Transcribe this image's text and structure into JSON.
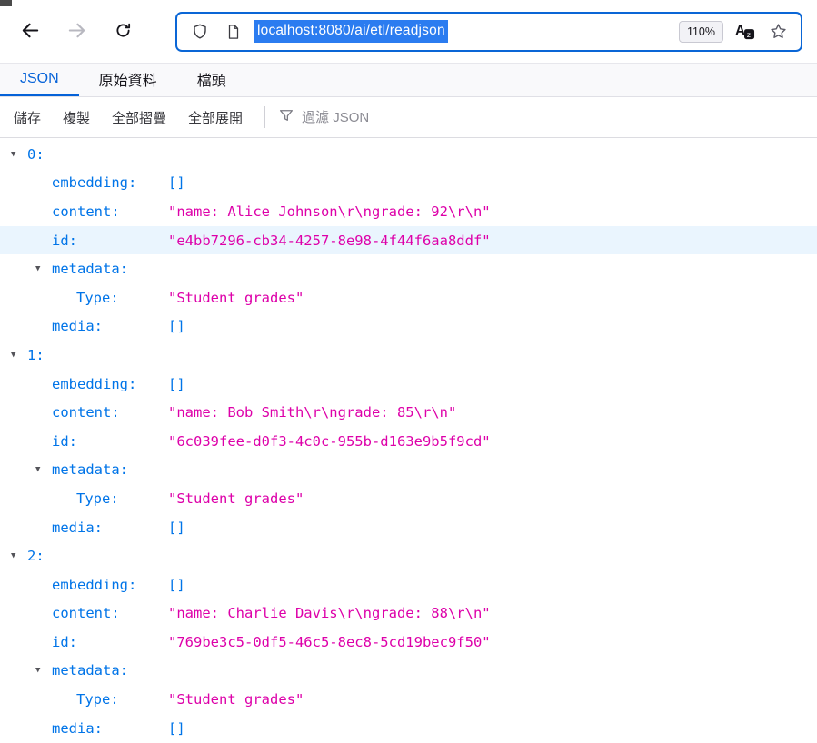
{
  "browser": {
    "url": "localhost:8080/ai/etl/readjson",
    "zoom": "110%"
  },
  "viewer_tabs": [
    {
      "name": "tab-json",
      "label": "JSON",
      "active": true
    },
    {
      "name": "tab-raw-data",
      "label": "原始資料",
      "active": false
    },
    {
      "name": "tab-headers",
      "label": "檔頭",
      "active": false
    }
  ],
  "toolbar": {
    "save": "儲存",
    "copy": "複製",
    "collapse_all": "全部摺疊",
    "expand_all": "全部展開",
    "filter_placeholder": "過濾 JSON"
  },
  "colors": {
    "key_blue": "#0074e8",
    "string_magenta": "#dd00a9",
    "accent_blue": "#0562d8",
    "url_selection_blue": "#2b7cf0",
    "row_highlight": "#eaf5fe"
  },
  "icons": {
    "back": "back-arrow-icon",
    "forward": "forward-arrow-icon",
    "reload": "reload-icon",
    "shield": "shield-icon",
    "page_info": "page-info-icon",
    "translate": "translate-icon",
    "bookmark": "bookmark-star-icon",
    "filter": "filter-funnel-icon",
    "expand": "expand-arrow-icon"
  },
  "tree_rows": [
    {
      "arrow": true,
      "indent": 0,
      "key": "0:",
      "value": "",
      "vtype": ""
    },
    {
      "arrow": false,
      "indent": 1,
      "key": "embedding:",
      "value": "[]",
      "vtype": "arr"
    },
    {
      "arrow": false,
      "indent": 1,
      "key": "content:",
      "value": "\"name: Alice Johnson\\r\\ngrade: 92\\r\\n\"",
      "vtype": "str"
    },
    {
      "arrow": false,
      "indent": 1,
      "key": "id:",
      "value": "\"e4bb7296-cb34-4257-8e98-4f44f6aa8ddf\"",
      "vtype": "str",
      "highlight": true
    },
    {
      "arrow": true,
      "indent": 1,
      "key": "metadata:",
      "value": "",
      "vtype": ""
    },
    {
      "arrow": false,
      "indent": 2,
      "key": "Type:",
      "value": "\"Student grades\"",
      "vtype": "str"
    },
    {
      "arrow": false,
      "indent": 1,
      "key": "media:",
      "value": "[]",
      "vtype": "arr"
    },
    {
      "arrow": true,
      "indent": 0,
      "key": "1:",
      "value": "",
      "vtype": ""
    },
    {
      "arrow": false,
      "indent": 1,
      "key": "embedding:",
      "value": "[]",
      "vtype": "arr"
    },
    {
      "arrow": false,
      "indent": 1,
      "key": "content:",
      "value": "\"name: Bob Smith\\r\\ngrade: 85\\r\\n\"",
      "vtype": "str"
    },
    {
      "arrow": false,
      "indent": 1,
      "key": "id:",
      "value": "\"6c039fee-d0f3-4c0c-955b-d163e9b5f9cd\"",
      "vtype": "str"
    },
    {
      "arrow": true,
      "indent": 1,
      "key": "metadata:",
      "value": "",
      "vtype": ""
    },
    {
      "arrow": false,
      "indent": 2,
      "key": "Type:",
      "value": "\"Student grades\"",
      "vtype": "str"
    },
    {
      "arrow": false,
      "indent": 1,
      "key": "media:",
      "value": "[]",
      "vtype": "arr"
    },
    {
      "arrow": true,
      "indent": 0,
      "key": "2:",
      "value": "",
      "vtype": ""
    },
    {
      "arrow": false,
      "indent": 1,
      "key": "embedding:",
      "value": "[]",
      "vtype": "arr"
    },
    {
      "arrow": false,
      "indent": 1,
      "key": "content:",
      "value": "\"name: Charlie Davis\\r\\ngrade: 88\\r\\n\"",
      "vtype": "str"
    },
    {
      "arrow": false,
      "indent": 1,
      "key": "id:",
      "value": "\"769be3c5-0df5-46c5-8ec8-5cd19bec9f50\"",
      "vtype": "str"
    },
    {
      "arrow": true,
      "indent": 1,
      "key": "metadata:",
      "value": "",
      "vtype": ""
    },
    {
      "arrow": false,
      "indent": 2,
      "key": "Type:",
      "value": "\"Student grades\"",
      "vtype": "str"
    },
    {
      "arrow": false,
      "indent": 1,
      "key": "media:",
      "value": "[]",
      "vtype": "arr"
    }
  ]
}
